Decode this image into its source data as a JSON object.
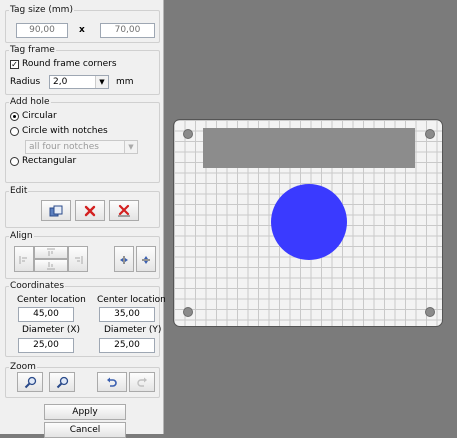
{
  "tag_size": {
    "legend": "Tag size (mm)",
    "width": "90,00",
    "separator": "x",
    "height": "70,00"
  },
  "tag_frame": {
    "legend": "Tag frame",
    "round_corners_label": "Round frame corners",
    "round_corners_checked": true,
    "radius_label": "Radius",
    "radius_value": "2,0",
    "radius_unit": "mm"
  },
  "add_hole": {
    "legend": "Add hole",
    "options": [
      {
        "label": "Circular",
        "selected": true
      },
      {
        "label": "Circle with notches",
        "selected": false
      },
      {
        "label": "Rectangular",
        "selected": false
      }
    ],
    "notches_value": "all four notches"
  },
  "edit": {
    "legend": "Edit",
    "buttons": [
      {
        "icon": "paste-icon"
      },
      {
        "icon": "delete-icon"
      },
      {
        "icon": "delete-all-icon"
      }
    ]
  },
  "align": {
    "legend": "Align",
    "buttons": [
      {
        "icon": "align-left-icon"
      },
      {
        "icon": "align-top-icon"
      },
      {
        "icon": "align-right-icon"
      },
      {
        "icon": "align-bottom-icon"
      },
      {
        "icon": "center-horizontal-icon"
      },
      {
        "icon": "center-vertical-icon"
      }
    ]
  },
  "coordinates": {
    "legend": "Coordinates",
    "center_x_label": "Center location",
    "center_x_value": "45,00",
    "center_y_label": "Center location",
    "center_y_value": "35,00",
    "diameter_x_label": "Diameter (X)",
    "diameter_x_value": "25,00",
    "diameter_y_label": "Diameter (Y)",
    "diameter_y_value": "25,00"
  },
  "zoom": {
    "legend": "Zoom",
    "buttons": [
      {
        "icon": "zoom-in-icon"
      },
      {
        "icon": "zoom-out-icon"
      },
      {
        "icon": "undo-icon"
      },
      {
        "icon": "redo-icon"
      }
    ]
  },
  "actions": {
    "apply_label": "Apply",
    "cancel_label": "Cancel"
  },
  "colors": {
    "hole_fill": "#3a3aff",
    "text_area_fill": "#8c8c8c",
    "canvas_background": "#7b7b7b",
    "delete_red": "#d32020"
  }
}
